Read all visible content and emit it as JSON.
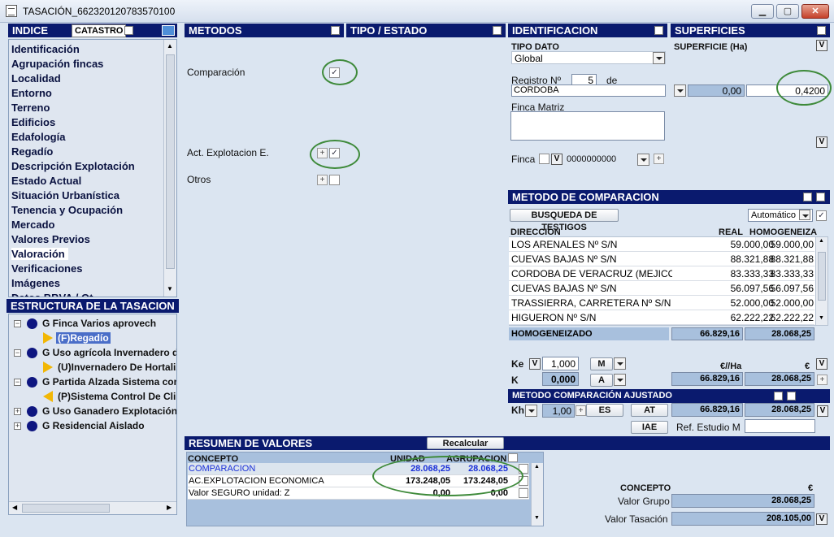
{
  "window": {
    "title": "TASACIÓN_662320120783570100",
    "min": "▁",
    "max": "▢",
    "close": "✕"
  },
  "indice": {
    "title": "INDICE",
    "catastro": "CATASTRO",
    "items": [
      "Identificación",
      "Agrupación fincas",
      "Localidad",
      "Entorno",
      "Terreno",
      "Edificios",
      "Edafología",
      "Regadío",
      "Descripción Explotación",
      "Estado Actual",
      "Situación Urbanística",
      "Tenencia y Ocupación",
      "Mercado",
      "Valores Previos",
      "Valoración",
      "Verificaciones",
      "Imágenes",
      "Datos BBVA / Ot..."
    ],
    "selected": "Valoración"
  },
  "estructura": {
    "title": "ESTRUCTURA DE LA TASACION",
    "nodes": [
      {
        "label": "G Finca Varios aprovech",
        "child": "(F)Regadío"
      },
      {
        "label": "G Uso agrícola Invernadero de",
        "child": "(U)Invernadero De Hortaliz"
      },
      {
        "label": "G Partida Alzada Sistema con",
        "child": "(P)Sistema Control De Clir"
      },
      {
        "label": "G Uso Ganadero Explotación p"
      },
      {
        "label": "G Residencial Aislado"
      }
    ]
  },
  "metodos": {
    "title": "METODOS",
    "comparacion": "Comparación",
    "act_explotacion": "Act. Explotacion E.",
    "otros": "Otros"
  },
  "tipo_estado": {
    "title": "TIPO / ESTADO"
  },
  "identificacion": {
    "title": "IDENTIFICACION",
    "tipo_dato_label": "TIPO DATO",
    "tipo_dato": "Global",
    "registro_label": "Registro Nº",
    "registro_num": "5",
    "de": "de",
    "registro_ciudad": "CORDOBA",
    "finca_matriz_label": "Finca Matriz",
    "finca_label": "Finca",
    "finca_num": "0000000000"
  },
  "superficies": {
    "title": "SUPERFICIES",
    "label": "SUPERFICIE (Ha)",
    "value1": "0,00",
    "value2": "0,4200"
  },
  "comparacion": {
    "title": "METODO DE COMPARACION",
    "busqueda": "BUSQUEDA DE TESTIGOS",
    "mode": "Automático",
    "col_dir": "DIRECCIÓN",
    "col_real": "REAL",
    "col_homog": "HOMOGENEIZA",
    "rows": [
      {
        "dir": "LOS ARENALES Nº S/N",
        "real": "59.000,00",
        "homog": "59.000,00"
      },
      {
        "dir": "CUEVAS BAJAS Nº S/N",
        "real": "88.321,88",
        "homog": "88.321,88"
      },
      {
        "dir": "CORDOBA DE VERACRUZ (MEJICO",
        "real": "83.333,33",
        "homog": "83.333,33"
      },
      {
        "dir": "CUEVAS BAJAS Nº S/N",
        "real": "56.097,56",
        "homog": "56.097,56"
      },
      {
        "dir": "TRASSIERRA, CARRETERA Nº S/N",
        "real": "52.000,00",
        "homog": "52.000,00"
      },
      {
        "dir": "HIGUERON Nº S/N",
        "real": "62.222,22",
        "homog": "62.222,22"
      }
    ],
    "homogeneizado_label": "HOMOGENEIZADO",
    "homogeneizado_real": "66.829,16",
    "homogeneizado_homog": "28.068,25",
    "ke_label": "Ke",
    "ke_value": "1,000",
    "ke_sel": "M",
    "k_label": "K",
    "k_value": "0,000",
    "k_sel": "A",
    "unit_ha": "€//Ha",
    "unit_eur": "€",
    "k_real": "66.829,16",
    "k_homog": "28.068,25"
  },
  "ajustado": {
    "title": "METODO COMPARACIÓN AJUSTADO",
    "kh_label": "Kh",
    "kh_value": "1,00",
    "es": "ES",
    "at": "AT",
    "real": "66.829,16",
    "homog": "28.068,25",
    "iae": "IAE",
    "ref_label": "Ref. Estudio M"
  },
  "resumen": {
    "title": "RESUMEN DE VALORES",
    "recalcular": "Recalcular",
    "col_concepto": "CONCEPTO",
    "col_unidad": "UNIDAD",
    "col_agrup": "AGRUPACION",
    "rows": [
      {
        "concepto": "COMPARACION",
        "unidad": "28.068,25",
        "agrup": "28.068,25"
      },
      {
        "concepto": "AC.EXPLOTACION ECONOMICA",
        "unidad": "173.248,05",
        "agrup": "173.248,05"
      },
      {
        "concepto": "Valor SEGURO unidad: Z",
        "unidad": "0,00",
        "agrup": "0,00"
      }
    ],
    "concepto_label": "CONCEPTO",
    "euro": "€",
    "valor_grupo_label": "Valor Grupo",
    "valor_grupo": "28.068,25",
    "valor_tasacion_label": "Valor Tasación",
    "valor_tasacion": "208.105,00"
  },
  "colors": {
    "header": "#0a1a6e",
    "field": "#a8c0dd",
    "highlight": "#3e8a3a",
    "link": "#1a2fd8"
  }
}
